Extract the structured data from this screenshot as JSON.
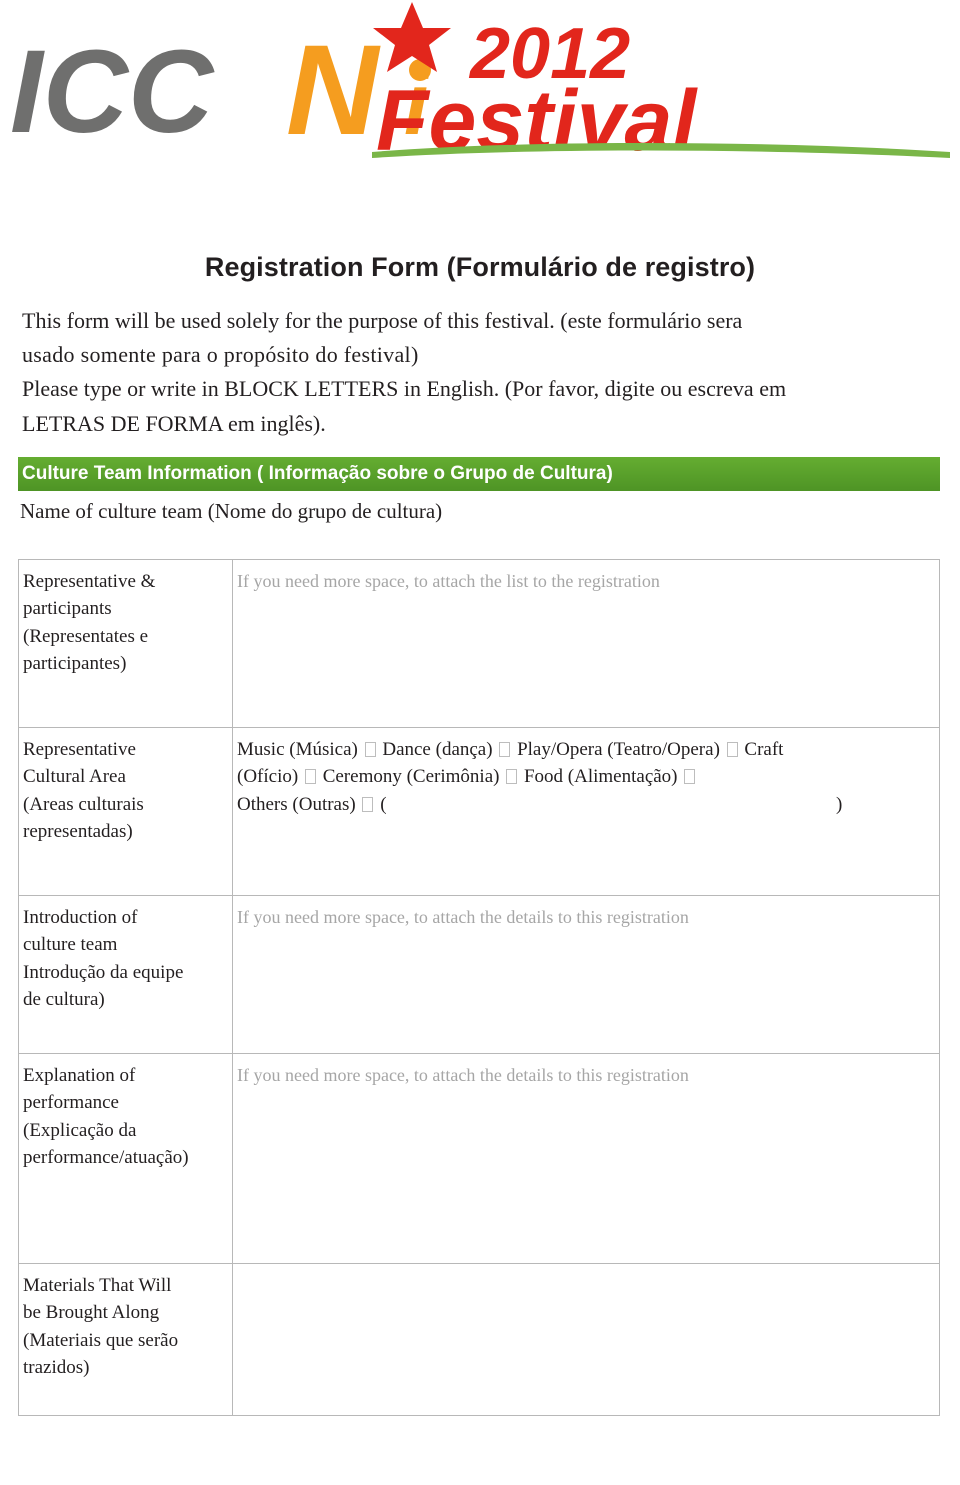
{
  "logo": {
    "text_iccn": "ICCN",
    "text_year": "2012",
    "text_festival": "Festival",
    "colors": {
      "grey": "#6f6f6e",
      "orange": "#f59d1f",
      "red": "#e2261c",
      "star": "#e2261c"
    }
  },
  "document": {
    "title": "Registration Form (Formulário de registro)",
    "intro": [
      "This form will be used solely for the purpose of this festival. (este formulário sera",
      "usado somente para o propósito do festival)",
      "Please type or write in BLOCK LETTERS in English. (Por favor, digite ou escreva em",
      "LETRAS DE FORMA em inglês)."
    ],
    "section_title": "Culture Team Information ( Informação sobre o Grupo de Cultura)",
    "name_line": "Name of culture team (Nome do grupo de cultura)",
    "section_color": "#5aa02c",
    "rows": [
      {
        "label_lines": [
          "Representative &",
          "participants",
          "(Representates e",
          "participantes)"
        ],
        "value_type": "hint",
        "value": "If you need more space, to attach the list to the registration"
      },
      {
        "label_lines": [
          "Representative",
          "Cultural Area",
          "(Areas culturais",
          "representadas)"
        ],
        "value_type": "checkboxes",
        "checkbox_lines": [
          [
            "Music (Música)",
            "Dance (dança)",
            " Play/Opera (Teatro/Opera)",
            " Craft"
          ],
          [
            "(Ofício)",
            " Ceremony (Cerimônia)",
            " Food (Alimentação)"
          ],
          [
            "Others (Outras)"
          ]
        ],
        "others_open": "(",
        "others_close": ")"
      },
      {
        "label_lines": [
          "Introduction of",
          "culture team",
          "Introdução da equipe",
          "de cultura)"
        ],
        "value_type": "hint",
        "value": "If you need more space, to attach the details to this registration"
      },
      {
        "label_lines": [
          "Explanation of",
          "performance",
          "(Explicação da",
          "performance/atuação)"
        ],
        "value_type": "hint",
        "value": "If you need more space, to attach the details to this registration"
      },
      {
        "label_lines": [
          "Materials  That  Will",
          "be Brought Along",
          "(Materiais  que  serão",
          "trazidos)"
        ],
        "value_type": "empty",
        "value": ""
      }
    ]
  }
}
